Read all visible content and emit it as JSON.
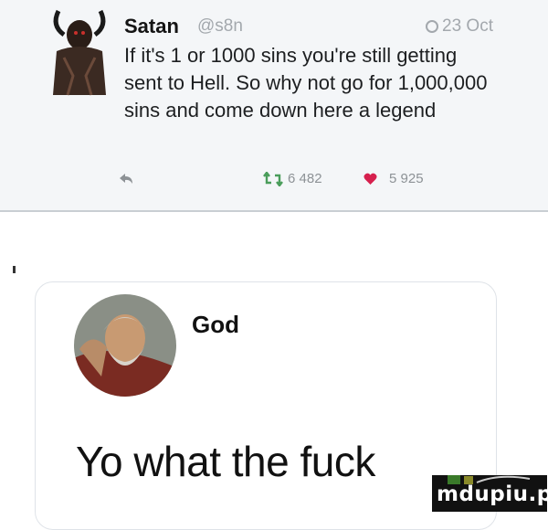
{
  "tweet": {
    "name": "Satan",
    "handle": "@s8n",
    "date": "23 Oct",
    "text": "If it's 1 or 1000 sins you're still getting sent to Hell. So why not go for 1,000,000 sins and come down here a legend",
    "retweets": "6 482",
    "likes": "5 925",
    "avatar_icon": "devil-avatar-icon",
    "reply_icon": "reply-arrow-icon",
    "retweet_icon": "retweet-icon",
    "like_icon": "heart-icon",
    "like_color": "#d6204e",
    "retweet_color": "#4a9d5b"
  },
  "reply": {
    "name": "God",
    "text": "Yo what the fuck",
    "avatar_icon": "god-painting-avatar-icon"
  },
  "watermark": {
    "text": "mdupiu.pl"
  }
}
